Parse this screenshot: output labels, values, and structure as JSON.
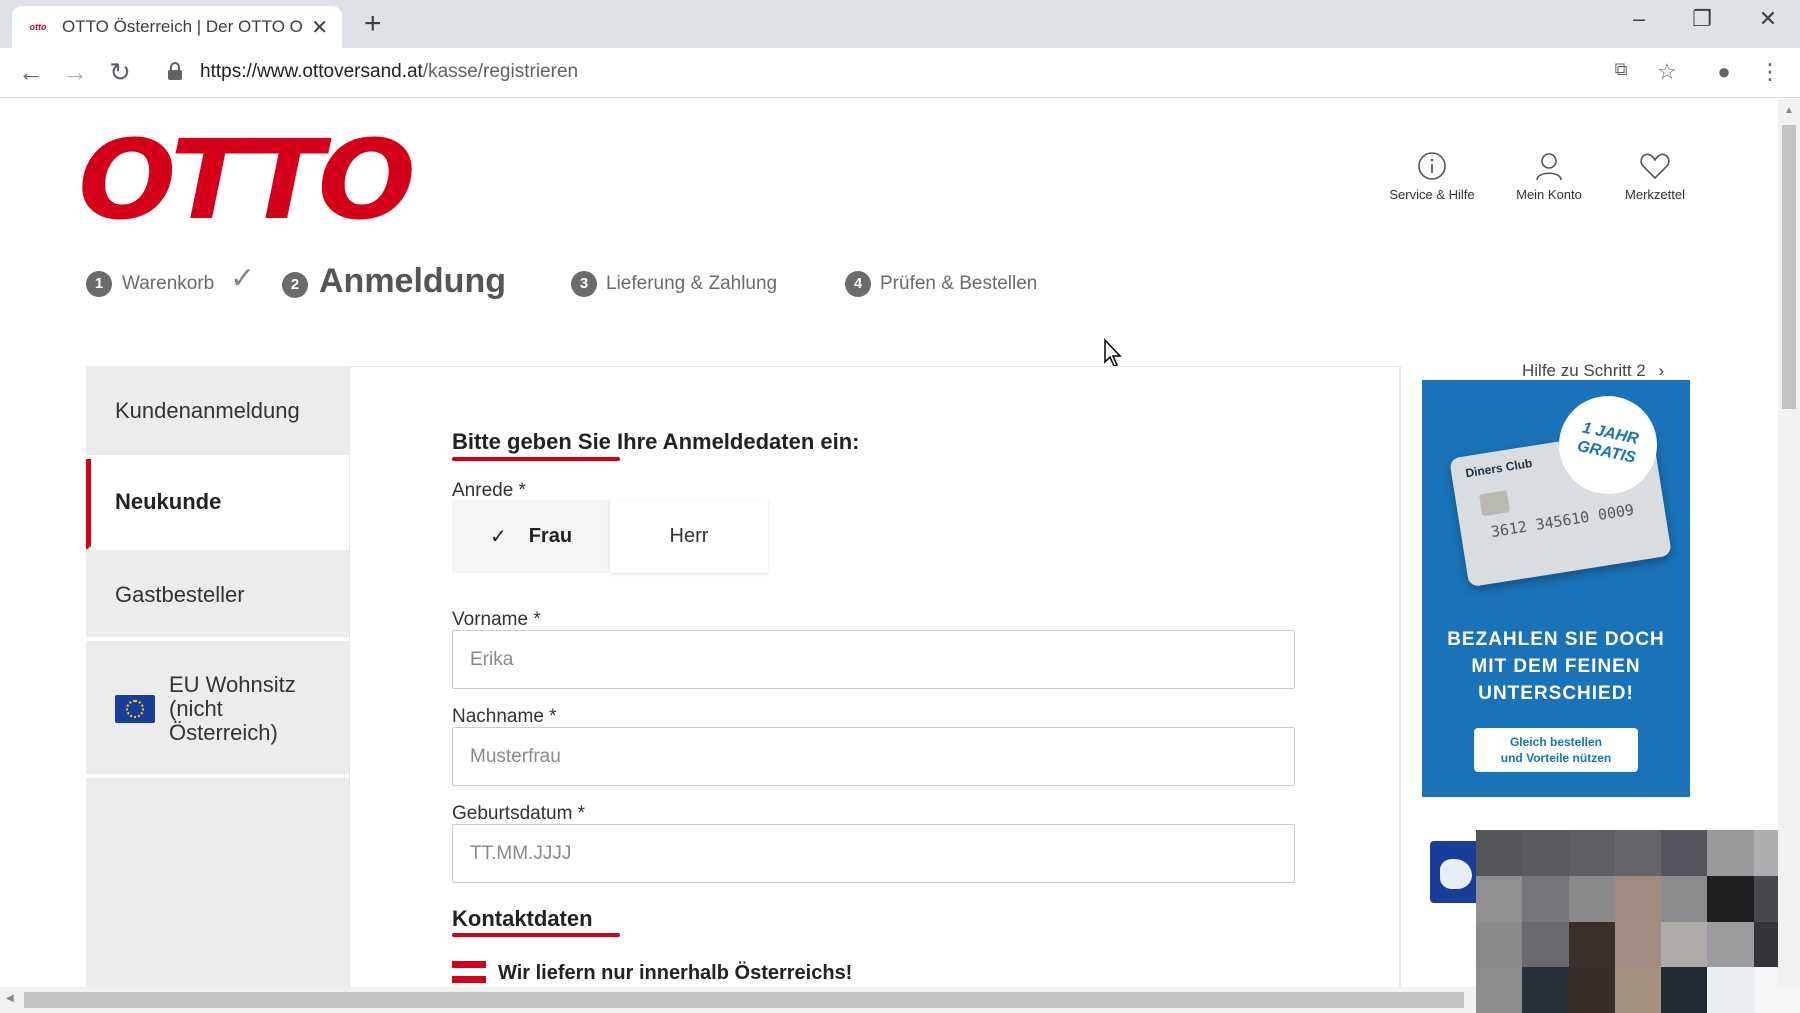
{
  "browser": {
    "tab_title": "OTTO Österreich | Der OTTO Onl",
    "favicon_text": "otto",
    "url_host": "https://www.ottoversand.at",
    "url_path": "/kasse/registrieren"
  },
  "header": {
    "logo": "OTTO",
    "service": "Service & Hilfe",
    "account": "Mein Konto",
    "wishlist": "Merkzettel"
  },
  "steps": [
    {
      "num": "1",
      "label": "Warenkorb"
    },
    {
      "num": "2",
      "label": "Anmeldung"
    },
    {
      "num": "3",
      "label": "Lieferung & Zahlung"
    },
    {
      "num": "4",
      "label": "Prüfen & Bestellen"
    }
  ],
  "sidebar": {
    "items": [
      {
        "label": "Kundenanmeldung"
      },
      {
        "label": "Neukunde"
      },
      {
        "label": "Gastbesteller"
      },
      {
        "label_lines": [
          "EU Wohnsitz",
          "(nicht",
          "Österreich)"
        ]
      }
    ]
  },
  "form": {
    "title": "Bitte geben Sie Ihre Anmeldedaten ein:",
    "salutation_label": "Anrede *",
    "salutation_options": [
      "Frau",
      "Herr"
    ],
    "salutation_selected": "Frau",
    "firstname_label": "Vorname *",
    "firstname_placeholder": "Erika",
    "lastname_label": "Nachname *",
    "lastname_placeholder": "Musterfrau",
    "birthdate_label": "Geburtsdatum *",
    "birthdate_placeholder": "TT.MM.JJJJ",
    "contact_heading": "Kontaktdaten",
    "delivery_notice": "Wir liefern nur innerhalb Österreichs!"
  },
  "aside": {
    "help_link": "Hilfe zu Schritt 2",
    "ad": {
      "badge_lines": [
        "1 JAHR",
        "GRATIS"
      ],
      "card_brand": "Diners Club",
      "card_number": "3612 345610 0009",
      "headline_lines": [
        "BEZAHLEN SIE DOCH",
        "MIT DEM FEINEN",
        "UNTERSCHIED!"
      ],
      "button_lines": [
        "Gleich bestellen",
        "und Vorteile nützen"
      ]
    }
  },
  "colors": {
    "brand_red": "#d4001a",
    "ad_blue": "#1a73b8",
    "sidebar_gray": "#ececec"
  }
}
